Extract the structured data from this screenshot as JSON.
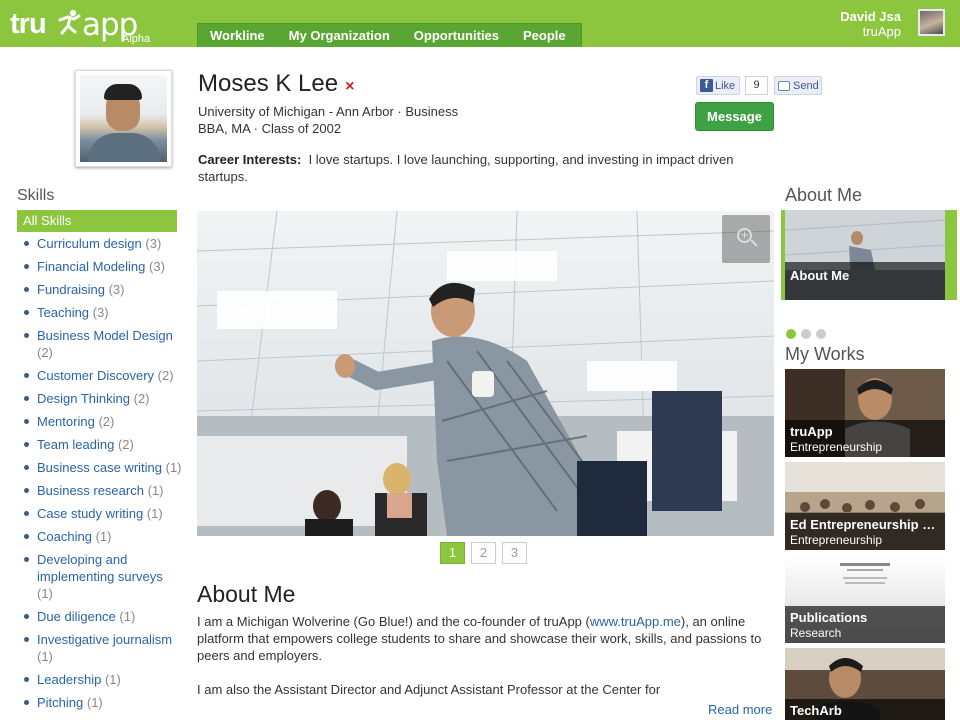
{
  "header": {
    "logo_left": "tru",
    "logo_right": "app",
    "logo_sub": "Alpha",
    "nav": [
      "Workline",
      "My Organization",
      "Opportunities",
      "People"
    ],
    "user_name": "David Jsa",
    "user_org": "truApp"
  },
  "profile": {
    "name": "Moses K Lee",
    "remove_mark": "×",
    "school_line": "University of Michigan - Ann Arbor · Business",
    "degree_line": "BBA, MA · Class of 2002",
    "career_label": "Career Interests:",
    "career_text": "I love startups. I love launching, supporting, and investing in impact driven startups.",
    "like_label": "Like",
    "like_count": "9",
    "send_label": "Send",
    "message_label": "Message"
  },
  "skills": {
    "title": "Skills",
    "all_label": "All Skills",
    "items": [
      {
        "name": "Curriculum design",
        "count": "(3)"
      },
      {
        "name": "Financial Modeling",
        "count": "(3)"
      },
      {
        "name": "Fundraising",
        "count": "(3)"
      },
      {
        "name": "Teaching",
        "count": "(3)"
      },
      {
        "name": "Business Model Design",
        "count": "(2)"
      },
      {
        "name": "Customer Discovery",
        "count": "(2)"
      },
      {
        "name": "Design Thinking",
        "count": "(2)"
      },
      {
        "name": "Mentoring",
        "count": "(2)"
      },
      {
        "name": "Team leading",
        "count": "(2)"
      },
      {
        "name": "Business case writing",
        "count": "(1)"
      },
      {
        "name": "Business research",
        "count": "(1)"
      },
      {
        "name": "Case study writing",
        "count": "(1)"
      },
      {
        "name": "Coaching",
        "count": "(1)"
      },
      {
        "name": "Developing and implementing surveys",
        "count": "(1)"
      },
      {
        "name": "Due diligence",
        "count": "(1)"
      },
      {
        "name": "Investigative journalism",
        "count": "(1)"
      },
      {
        "name": "Leadership",
        "count": "(1)"
      },
      {
        "name": "Pitching",
        "count": "(1)"
      }
    ]
  },
  "gallery": {
    "pages": [
      "1",
      "2",
      "3"
    ],
    "active_page": "1"
  },
  "about": {
    "title": "About Me",
    "text_a": "I am a Michigan Wolverine (Go Blue!) and the co-founder of truApp (",
    "link": "www.truApp.me",
    "text_b": "), an online platform that empowers college students to share and showcase their work, skills, and passions to peers and employers.",
    "text2": "I am also the Assistant Director and Adjunct Assistant Professor at the Center for",
    "read_more": "Read more"
  },
  "right": {
    "about_title": "About Me",
    "about_card": "About Me",
    "works_title": "My Works",
    "works": [
      {
        "title": "truApp",
        "sub": "Entrepreneurship"
      },
      {
        "title": "Ed Entrepreneurship S…",
        "sub": "Entrepreneurship"
      },
      {
        "title": "Publications",
        "sub": "Research"
      },
      {
        "title": "TechArb",
        "sub": ""
      }
    ]
  },
  "colors": {
    "brand_green": "#8cc63f",
    "nav_green": "#5aa632",
    "button_green": "#3ea143",
    "link_blue": "#2a64a8"
  }
}
